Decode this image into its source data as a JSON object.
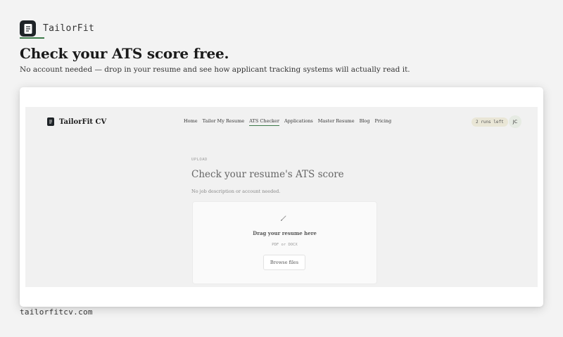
{
  "brand": {
    "name": "TailorFit",
    "icon": "resume-document-icon"
  },
  "hero": {
    "title": "Check your ATS score free.",
    "subtitle": "No account needed — drop in your resume and see how applicant tracking systems will actually read it."
  },
  "app": {
    "logo_text": "TailorFit CV",
    "nav": [
      {
        "label": "Home",
        "active": false
      },
      {
        "label": "Tailor My Resume",
        "active": false
      },
      {
        "label": "ATS Checker",
        "active": true
      },
      {
        "label": "Applications",
        "active": false
      },
      {
        "label": "Master Resume",
        "active": false
      },
      {
        "label": "Blog",
        "active": false
      },
      {
        "label": "Pricing",
        "active": false
      }
    ],
    "runs_left": "2 runs left",
    "avatar_initials": "JC",
    "upload": {
      "eyebrow": "UPLOAD",
      "title": "Check your resume's ATS score",
      "subtitle": "No job description or account needed.",
      "dropzone": {
        "icon": "pencil-icon",
        "title": "Drag your resume here",
        "types": "PDF or DOCX",
        "button": "Browse files"
      }
    }
  },
  "footer": {
    "url": "tailorfitcv.com"
  },
  "colors": {
    "accent": "#3d7a4a",
    "logo_bg": "#1e2327",
    "page_bg": "#f3f3f3"
  }
}
